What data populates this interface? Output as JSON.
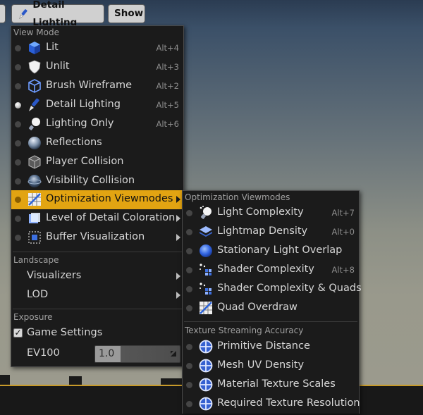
{
  "toolbar": {
    "view_mode_button": "Detail Lighting",
    "show_button": "Show"
  },
  "menu": {
    "view_mode_header": "View Mode",
    "items": [
      {
        "label": "Lit",
        "shortcut": "Alt+4",
        "icon": "lit-cube-icon"
      },
      {
        "label": "Unlit",
        "shortcut": "Alt+3",
        "icon": "unlit-shield-icon"
      },
      {
        "label": "Brush Wireframe",
        "shortcut": "Alt+2",
        "icon": "wireframe-cube-icon"
      },
      {
        "label": "Detail Lighting",
        "shortcut": "Alt+5",
        "icon": "detail-lighting-brush-icon",
        "selected": true
      },
      {
        "label": "Lighting Only",
        "shortcut": "Alt+6",
        "icon": "lighting-only-bulb-icon"
      },
      {
        "label": "Reflections",
        "shortcut": "",
        "icon": "reflections-sphere-icon"
      },
      {
        "label": "Player Collision",
        "shortcut": "",
        "icon": "player-collision-cube-icon"
      },
      {
        "label": "Visibility Collision",
        "shortcut": "",
        "icon": "visibility-collision-sphere-icon"
      },
      {
        "label": "Optimization Viewmodes",
        "shortcut": "",
        "icon": "optimization-grid-icon",
        "submenu": true,
        "highlighted": true
      },
      {
        "label": "Level of Detail Coloration",
        "shortcut": "",
        "icon": "lod-coloration-icon",
        "submenu": true
      },
      {
        "label": "Buffer Visualization",
        "shortcut": "",
        "icon": "buffer-visualization-icon",
        "submenu": true
      }
    ],
    "landscape_header": "Landscape",
    "landscape_items": [
      {
        "label": "Visualizers"
      },
      {
        "label": "LOD"
      }
    ],
    "exposure_header": "Exposure",
    "game_settings_label": "Game Settings",
    "game_settings_checked": true,
    "ev100_label": "EV100",
    "ev100_value": "1.0"
  },
  "submenu": {
    "optimization_header": "Optimization Viewmodes",
    "optimization_items": [
      {
        "label": "Light Complexity",
        "shortcut": "Alt+7",
        "icon": "light-complexity-icon"
      },
      {
        "label": "Lightmap Density",
        "shortcut": "Alt+0",
        "icon": "lightmap-density-icon"
      },
      {
        "label": "Stationary Light Overlap",
        "shortcut": "",
        "icon": "stationary-light-overlap-icon"
      },
      {
        "label": "Shader Complexity",
        "shortcut": "Alt+8",
        "icon": "shader-complexity-icon"
      },
      {
        "label": "Shader Complexity & Quads",
        "shortcut": "",
        "icon": "shader-complexity-quads-icon"
      },
      {
        "label": "Quad Overdraw",
        "shortcut": "",
        "icon": "quad-overdraw-icon"
      }
    ],
    "texture_header": "Texture Streaming Accuracy",
    "texture_items": [
      {
        "label": "Primitive Distance",
        "icon": "crosshair-circle-icon"
      },
      {
        "label": "Mesh UV Density",
        "icon": "crosshair-circle-icon"
      },
      {
        "label": "Material Texture Scales",
        "icon": "crosshair-circle-icon"
      },
      {
        "label": "Required Texture Resolution",
        "icon": "crosshair-circle-icon"
      }
    ]
  },
  "colors": {
    "highlight": "#e2a412",
    "menu_bg": "#1b1b1b",
    "accent_line": "#c79a2a"
  }
}
